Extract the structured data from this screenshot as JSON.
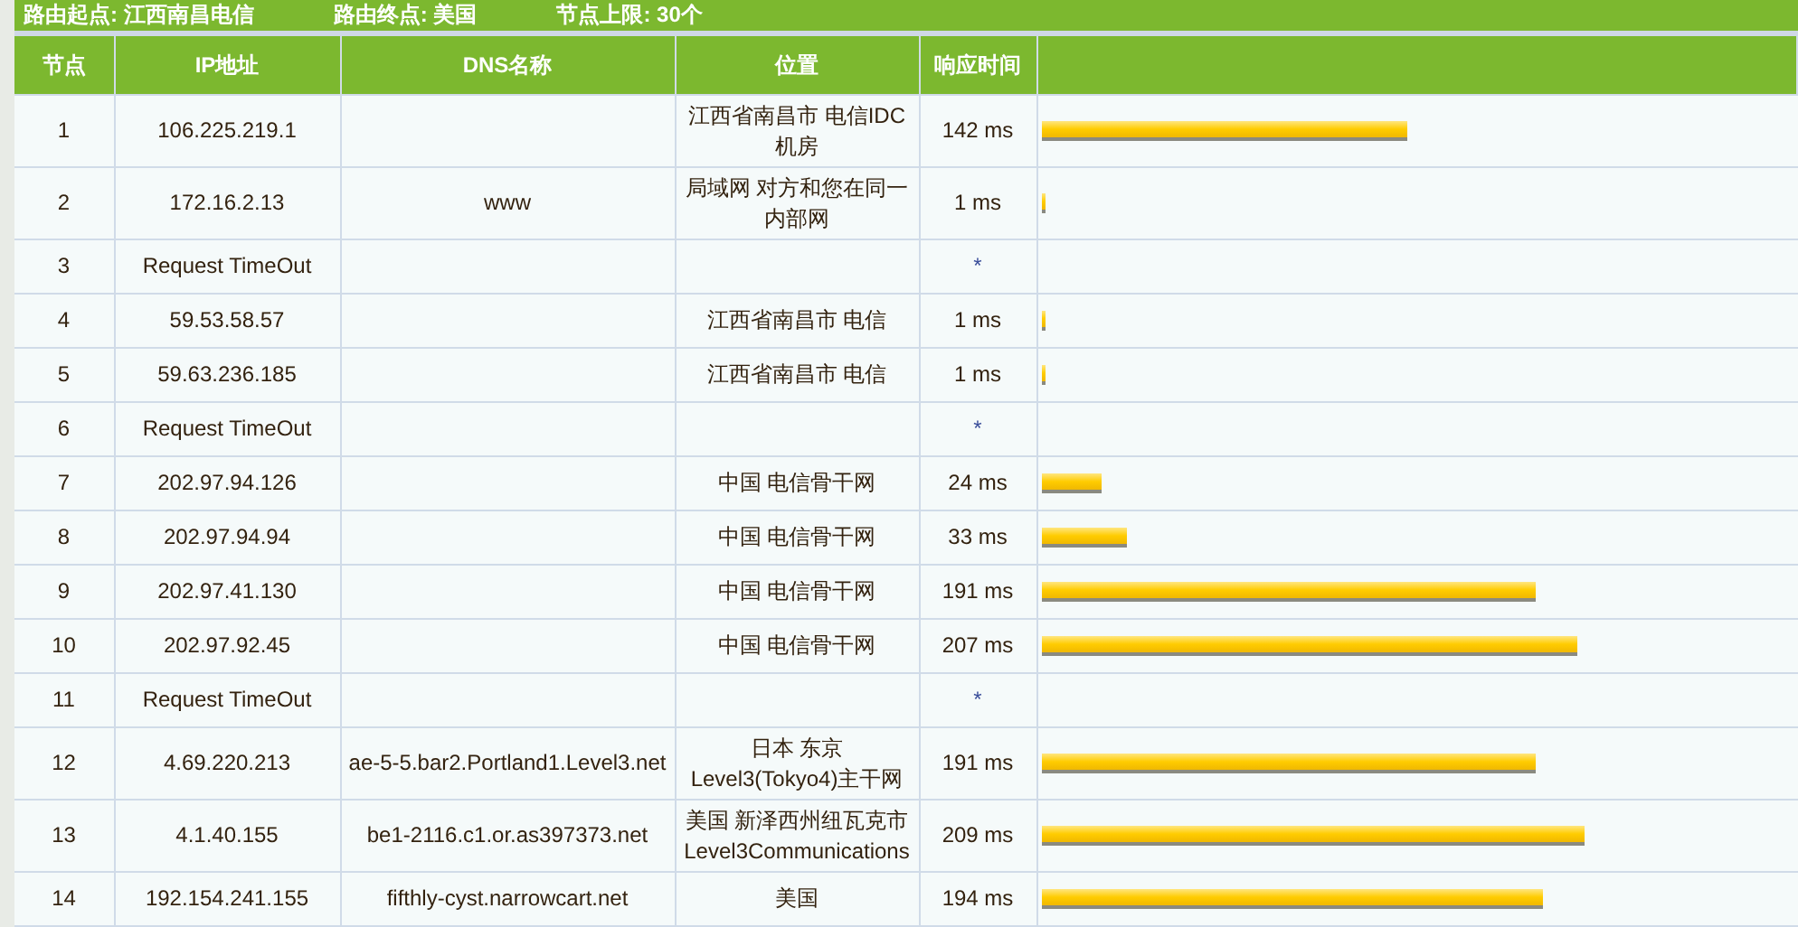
{
  "summary": [
    {
      "label": "路由起点:",
      "value": "江西南昌电信"
    },
    {
      "label": "路由终点:",
      "value": "美国"
    },
    {
      "label": "节点上限:",
      "value": "30个"
    }
  ],
  "table": {
    "columns": [
      "节点",
      "IP地址",
      "DNS名称",
      "位置",
      "响应时间"
    ],
    "rows": [
      {
        "kind": "reply",
        "hop": "1",
        "ip": "106.225.219.1",
        "location": "江西省南昌市 电信IDC机房",
        "time": "142 ms",
        "level": 0.49
      },
      {
        "kind": "reply",
        "hop": "2",
        "ip": "172.16.2.13",
        "dns": "www",
        "location": "局域网 对方和您在同一内部网",
        "time": "1 ms",
        "level": 0.005
      },
      {
        "kind": "timeout",
        "hop": "3",
        "ip": "Request TimeOut",
        "time": "*"
      },
      {
        "kind": "reply",
        "hop": "4",
        "ip": "59.53.58.57",
        "location": "江西省南昌市 电信",
        "time": "1 ms",
        "level": 0.005
      },
      {
        "kind": "reply",
        "hop": "5",
        "ip": "59.63.236.185",
        "location": "江西省南昌市 电信",
        "time": "1 ms",
        "level": 0.005
      },
      {
        "kind": "timeout",
        "hop": "6",
        "ip": "Request TimeOut",
        "time": "*"
      },
      {
        "kind": "reply",
        "hop": "7",
        "ip": "202.97.94.126",
        "location": "中国 电信骨干网",
        "time": "24 ms",
        "level": 0.082
      },
      {
        "kind": "reply",
        "hop": "8",
        "ip": "202.97.94.94",
        "location": "中国 电信骨干网",
        "time": "33 ms",
        "level": 0.114
      },
      {
        "kind": "reply",
        "hop": "9",
        "ip": "202.97.41.130",
        "location": "中国 电信骨干网",
        "time": "191 ms",
        "level": 0.66
      },
      {
        "kind": "reply",
        "hop": "10",
        "ip": "202.97.92.45",
        "location": "中国 电信骨干网",
        "time": "207 ms",
        "level": 0.717
      },
      {
        "kind": "timeout",
        "hop": "11",
        "ip": "Request TimeOut",
        "time": "*"
      },
      {
        "kind": "reply",
        "hop": "12",
        "ip": "4.69.220.213",
        "dns": "ae-5-5.bar2.Portland1.Level3.net",
        "location": "日本 东京Level3(Tokyo4)主干网",
        "time": "191 ms",
        "level": 0.66
      },
      {
        "kind": "reply",
        "hop": "13",
        "ip": "4.1.40.155",
        "dns": "be1-2116.c1.or.as397373.net",
        "location": "美国 新泽西州纽瓦克市Level3Communications",
        "time": "209 ms",
        "level": 0.725
      },
      {
        "kind": "reply",
        "hop": "14",
        "ip": "192.154.241.155",
        "dns": "fifthly-cyst.narrowcart.net",
        "location": "美国",
        "time": "194 ms",
        "level": 0.67
      }
    ]
  }
}
